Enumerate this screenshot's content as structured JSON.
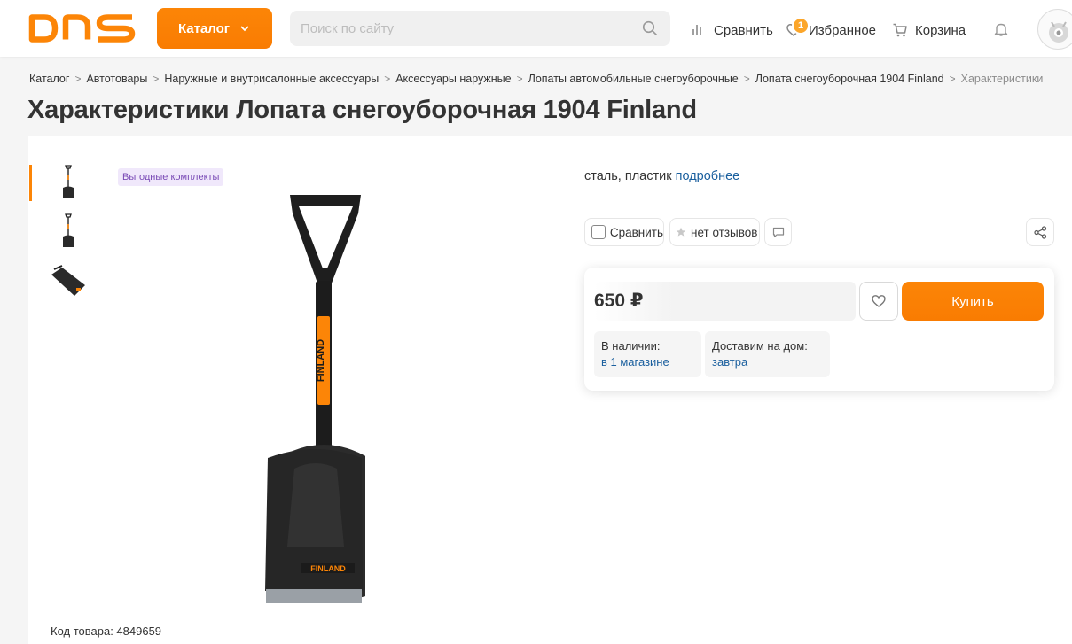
{
  "header": {
    "logo_text": "DNS",
    "catalog_label": "Каталог",
    "search_placeholder": "Поиск по сайту",
    "compare_label": "Сравнить",
    "favorites_label": "Избранное",
    "favorites_count": "1",
    "cart_label": "Корзина"
  },
  "breadcrumbs": [
    "Каталог",
    "Автотовары",
    "Наружные и внутрисалонные аксессуары",
    "Аксессуары наружные",
    "Лопаты автомобильные снегоуборочные",
    "Лопата снегоуборочная 1904 Finland",
    "Характеристики"
  ],
  "page_title": "Характеристики Лопата снегоуборочная 1904 Finland",
  "product": {
    "promo_tag": "Выгодные комплекты",
    "brand_on_image": "FINLAND",
    "sku_label": "Код товара: 4849659",
    "material_text": "сталь, пластик",
    "material_more": "подробнее",
    "compare_chip": "Сравнить",
    "reviews_chip": "нет отзывов",
    "price": "650 ₽",
    "buy_label": "Купить",
    "availability_label": "В наличии:",
    "availability_value": "в 1 магазине",
    "delivery_label": "Доставим на дом:",
    "delivery_value": "завтра"
  },
  "colors": {
    "brand_orange": "#fc8507",
    "link_blue": "#1a5f9e",
    "promo_purple": "#7a4bb6"
  },
  "icons": [
    "chevron-down-icon",
    "search-icon",
    "compare-bars-icon",
    "heart-icon",
    "cart-icon",
    "bell-icon",
    "star-icon",
    "comment-icon",
    "share-icon"
  ]
}
